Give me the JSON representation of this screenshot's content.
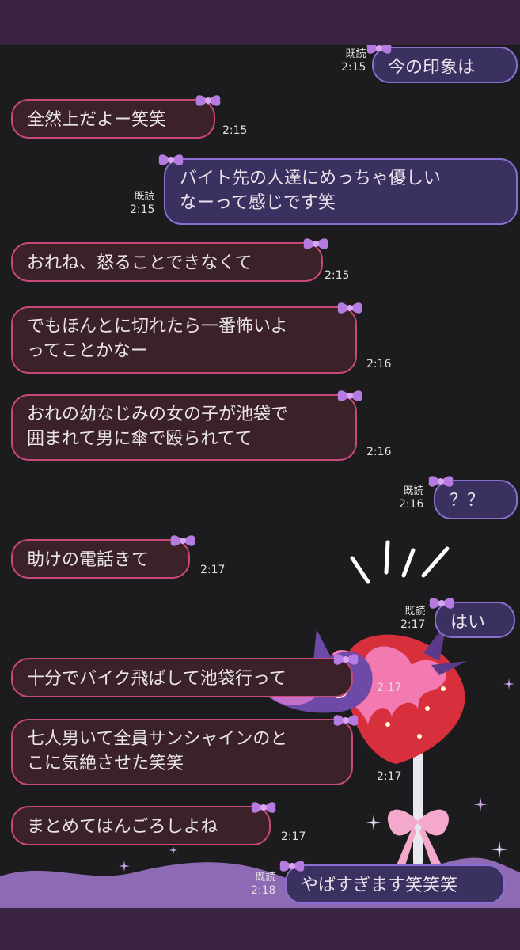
{
  "messages": [
    {
      "side": "out",
      "text": [
        "今の印象は"
      ],
      "read": "既読",
      "time": "2:15"
    },
    {
      "side": "in",
      "text": [
        "全然上だよー笑笑"
      ],
      "time": "2:15"
    },
    {
      "side": "out",
      "text": [
        "バイト先の人達にめっちゃ優しい",
        "なーって感じです笑"
      ],
      "read": "既読",
      "time": "2:15"
    },
    {
      "side": "in",
      "text": [
        "おれね、怒ることできなくて"
      ],
      "time": "2:15"
    },
    {
      "side": "in",
      "text": [
        "でもほんとに切れたら一番怖いよ",
        "ってことかなー"
      ],
      "time": "2:16"
    },
    {
      "side": "in",
      "text": [
        "おれの幼なじみの女の子が池袋で",
        "囲まれて男に傘で殴られてて"
      ],
      "time": "2:16"
    },
    {
      "side": "out",
      "text": [
        "？？"
      ],
      "read": "既読",
      "time": "2:16"
    },
    {
      "side": "in",
      "text": [
        "助けの電話きて"
      ],
      "time": "2:17"
    },
    {
      "side": "out",
      "text": [
        "はい"
      ],
      "read": "既読",
      "time": "2:17"
    },
    {
      "side": "in",
      "text": [
        "十分でバイク飛ばして池袋行って"
      ],
      "time": "2:17"
    },
    {
      "side": "in",
      "text": [
        "七人男いて全員サンシャインのと",
        "こに気絶させた笑笑"
      ],
      "time": "2:17"
    },
    {
      "side": "in",
      "text": [
        "まとめてはんごろしよね"
      ],
      "time": "2:17"
    },
    {
      "side": "out",
      "text": [
        "やばすぎます笑笑笑"
      ],
      "read": "既読",
      "time": "2:18"
    }
  ],
  "colors": {
    "bar": "#3a2442",
    "incoming_bg": "#3b2128",
    "incoming_border": "#c9497c",
    "outgoing_bg": "#3b3160",
    "outgoing_border": "#8a6fd0",
    "bow": "#b57be0"
  },
  "icons": {
    "bow": "ribbon-bow-icon",
    "sticker": "strawberry-fork-sticker"
  }
}
